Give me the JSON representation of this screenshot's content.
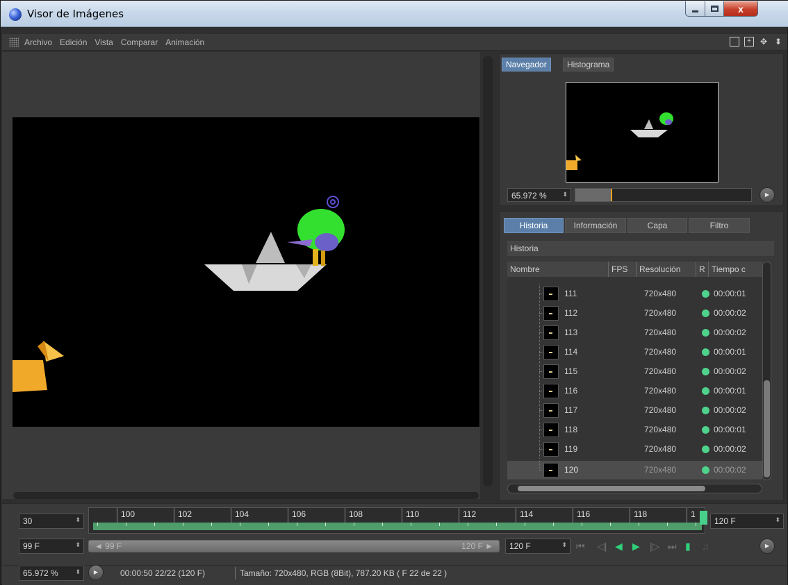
{
  "window": {
    "title": "Visor de Imágenes",
    "close_glyph": "x",
    "icons": [
      "app-icon",
      "minimize-icon",
      "maximize-icon",
      "close-icon"
    ]
  },
  "menu": {
    "items": [
      "Archivo",
      "Edición",
      "Vista",
      "Comparar",
      "Animación"
    ],
    "right_icons": [
      "single-pane-icon",
      "expand-pane-icon",
      "move-icon",
      "dock-icon"
    ]
  },
  "navigator": {
    "tabs": [
      "Navegador",
      "Histograma"
    ],
    "zoom_value": "65.972 %"
  },
  "history": {
    "tabs": [
      "Historia",
      "Información",
      "Capa",
      "Filtro"
    ],
    "section_title": "Historia",
    "columns": [
      "Nombre",
      "FPS",
      "Resolución",
      "R",
      "Tiempo c"
    ],
    "rows": [
      {
        "name": "111",
        "res": "720x480",
        "time": "00:00:01"
      },
      {
        "name": "112",
        "res": "720x480",
        "time": "00:00:02"
      },
      {
        "name": "113",
        "res": "720x480",
        "time": "00:00:02"
      },
      {
        "name": "114",
        "res": "720x480",
        "time": "00:00:01"
      },
      {
        "name": "115",
        "res": "720x480",
        "time": "00:00:02"
      },
      {
        "name": "116",
        "res": "720x480",
        "time": "00:00:01"
      },
      {
        "name": "117",
        "res": "720x480",
        "time": "00:00:02"
      },
      {
        "name": "118",
        "res": "720x480",
        "time": "00:00:01"
      },
      {
        "name": "119",
        "res": "720x480",
        "time": "00:00:02"
      },
      {
        "name": "120",
        "res": "720x480",
        "time": "00:00:02"
      }
    ],
    "selected_row": "120",
    "status_color": "#4fd28b"
  },
  "timeline": {
    "fps": "30",
    "ticks": [
      "100",
      "102",
      "104",
      "106",
      "108",
      "110",
      "112",
      "114",
      "116",
      "118",
      "1"
    ],
    "end_frame": "120 F",
    "range_start": "99 F",
    "range_start_label": "◄ 99 F",
    "range_end_label": "120 F ►",
    "range_end": "120 F",
    "accent": "#48d08a"
  },
  "status": {
    "zoom": "65.972 %",
    "info": "00:00:50 22/22 (120 F)",
    "details": "Tamaño: 720x480, RGB (8Bit), 787.20 KB ( F 22 de 22 )"
  }
}
